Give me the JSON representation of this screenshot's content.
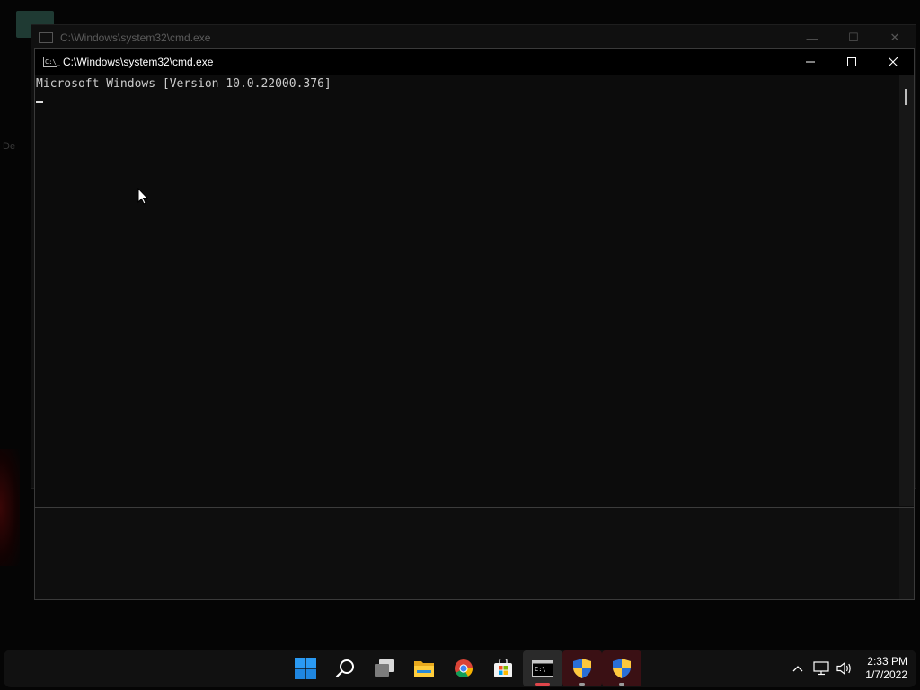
{
  "desktop": {
    "partial_label": "De"
  },
  "background_window": {
    "title": "C:\\Windows\\system32\\cmd.exe",
    "controls": {
      "minimize": "—",
      "maximize": "☐",
      "close": "✕"
    }
  },
  "window": {
    "title": "C:\\Windows\\system32\\cmd.exe",
    "icon_text": "C:\\_",
    "console_lines": "Microsoft Windows [Version 10.0.22000.376]",
    "controls": {
      "minimize": "minimize",
      "maximize": "maximize",
      "close": "close"
    }
  },
  "taskbar": {
    "apps": [
      {
        "name": "start",
        "icon": "windows-logo-icon"
      },
      {
        "name": "search",
        "icon": "search-icon"
      },
      {
        "name": "task-view",
        "icon": "task-view-icon"
      },
      {
        "name": "file-explorer",
        "icon": "folder-icon"
      },
      {
        "name": "chrome",
        "icon": "chrome-icon"
      },
      {
        "name": "microsoft-store",
        "icon": "store-icon"
      },
      {
        "name": "command-prompt",
        "icon": "cmd-icon",
        "state": "active"
      },
      {
        "name": "uac-prompt-1",
        "icon": "shield-icon",
        "state": "flashing"
      },
      {
        "name": "uac-prompt-2",
        "icon": "shield-icon",
        "state": "flashing"
      }
    ],
    "tray": {
      "icons": [
        "chevron-up-icon",
        "network-icon",
        "volume-icon"
      ],
      "time": "2:33 PM",
      "date": "1/7/2022"
    }
  },
  "colors": {
    "console_bg": "#0c0c0c",
    "console_text": "#cccccc",
    "taskbar_bg": "#111111",
    "accent_blue": "#0078d4",
    "flash_red": "#e0464b"
  }
}
